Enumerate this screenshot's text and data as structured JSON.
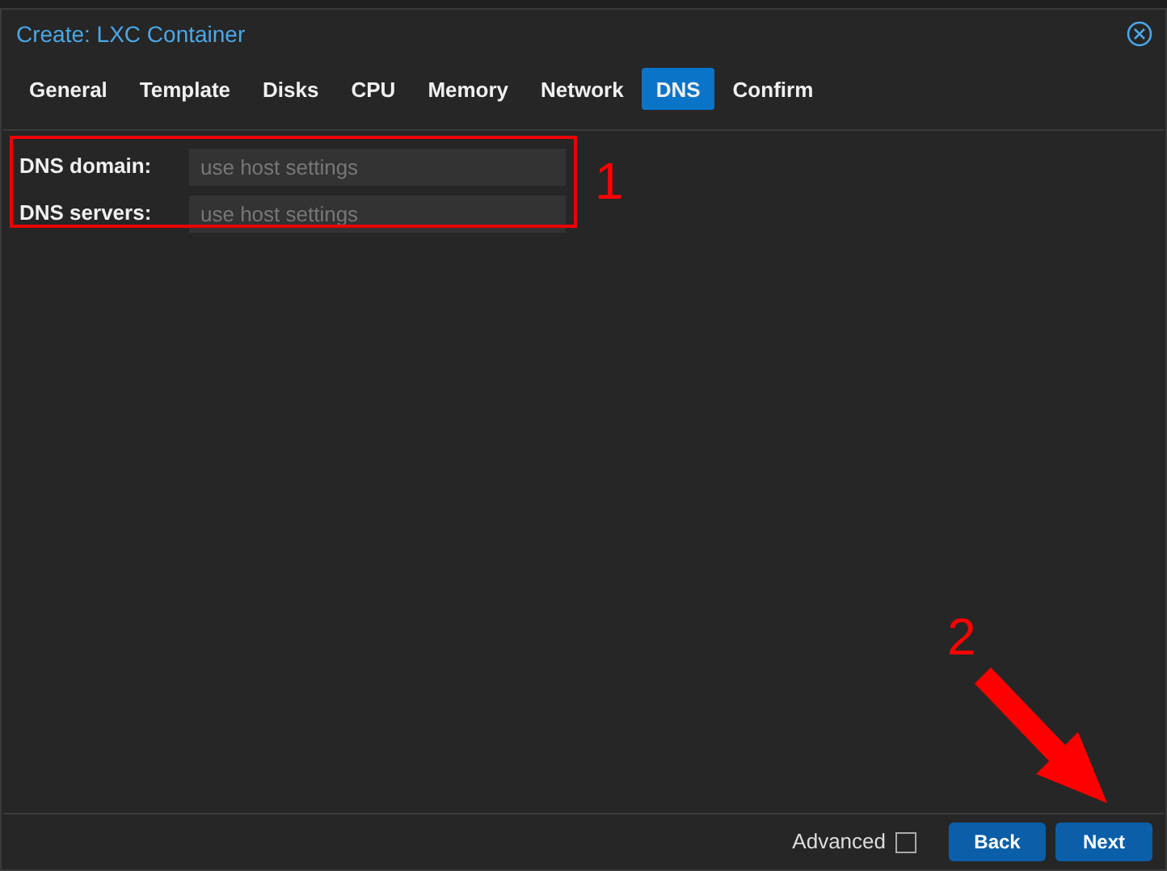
{
  "window": {
    "title": "Create: LXC Container"
  },
  "tabs": [
    {
      "label": "General",
      "selected": false
    },
    {
      "label": "Template",
      "selected": false
    },
    {
      "label": "Disks",
      "selected": false
    },
    {
      "label": "CPU",
      "selected": false
    },
    {
      "label": "Memory",
      "selected": false
    },
    {
      "label": "Network",
      "selected": false
    },
    {
      "label": "DNS",
      "selected": true
    },
    {
      "label": "Confirm",
      "selected": false
    }
  ],
  "fields": [
    {
      "label": "DNS domain:",
      "placeholder": "use host settings"
    },
    {
      "label": "DNS servers:",
      "placeholder": "use host settings"
    }
  ],
  "footer": {
    "advanced": {
      "label": "Advanced",
      "checked": false
    },
    "buttons": [
      "Back",
      "Next"
    ]
  },
  "annotations": [
    {
      "label": "1"
    },
    {
      "label": "2"
    }
  ]
}
